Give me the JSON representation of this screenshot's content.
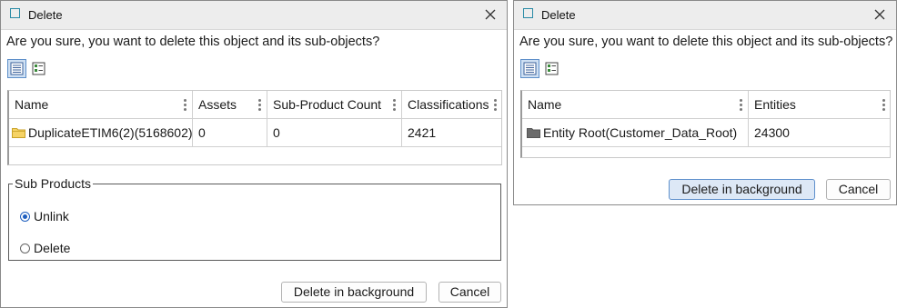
{
  "dialog1": {
    "title": "Delete",
    "question": "Are you sure, you want to delete this object and its sub-objects?",
    "columns": [
      "Name",
      "Assets",
      "Sub-Product Count",
      "Classifications"
    ],
    "rows": [
      {
        "name": "DuplicateETIM6(2)(5168602)",
        "assets": "0",
        "sub_product_count": "0",
        "classifications": "2421",
        "icon": "folder-yellow-icon"
      }
    ],
    "group": {
      "legend": "Sub Products",
      "options": [
        {
          "label": "Unlink",
          "checked": true
        },
        {
          "label": "Delete",
          "checked": false
        }
      ]
    },
    "buttons": {
      "background": "Delete in background",
      "cancel": "Cancel"
    }
  },
  "dialog2": {
    "title": "Delete",
    "question": "Are you sure, you want to delete this object and its sub-objects?",
    "columns": [
      "Name",
      "Entities"
    ],
    "rows": [
      {
        "name": "Entity Root(Customer_Data_Root)",
        "entities": "24300",
        "icon": "folder-gray-icon"
      }
    ],
    "buttons": {
      "background": "Delete in background",
      "cancel": "Cancel"
    }
  },
  "colors": {
    "titlebar": "#ededed",
    "accent": "#1f5fbf",
    "title_icon": "#2a8ba6",
    "folder_yellow": "#f2c94c",
    "folder_gray": "#6b6b6b"
  }
}
